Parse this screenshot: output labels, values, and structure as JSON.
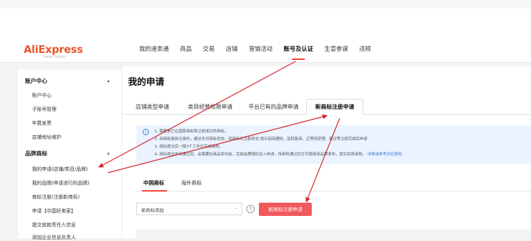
{
  "header": {
    "logo": "AliExpress",
    "logo_sub": "Seller Center",
    "nav": [
      "我的速卖通",
      "商品",
      "交易",
      "店铺",
      "营销活动",
      "账号及认证",
      "生意参谋",
      "违规"
    ],
    "active_nav": "账号及认证"
  },
  "sidebar": {
    "group1": {
      "label": "账户中心",
      "toggle": "▴",
      "items": [
        "账户中心",
        "子账号管理",
        "年费发票",
        "店铺地址维护"
      ]
    },
    "group2": {
      "label": "品牌商标",
      "toggle": "▴",
      "items": [
        "我的申请(店铺/类目/品牌)",
        "我的品牌(申请进行的品牌)",
        "商标注册(注册新商标)",
        "申请【中国好卖家】",
        "提交放款责任人信息",
        "添加企业信息负责人"
      ]
    }
  },
  "main": {
    "title": "我的申请",
    "tabs": [
      "店铺类型申请",
      "类目经营权限申请",
      "平台已有的品牌申请",
      "新商标注册申请"
    ],
    "active_tab": "新商标注册申请",
    "notice": {
      "icon": "info-icon",
      "lines": [
        "1. 需要是已在国家商标局注册成功的商标。",
        "2. 如商标是新注册的，建议先对商标状态，如商标对注册状态 提示驳回通知、驳回复审，正等待受理，建议等注册完成后申请",
        "3. 商标提交后一般3个工作日完成审核。",
        "4. 商标提交申请通过后，会需要在商品发布前，完成品牌授权及入申请，待审核通过后方可使用该品牌发布，提交后续审核。"
      ],
      "link": "详情请参考对应规则。"
    },
    "subtabs": [
      "中国商标",
      "海外商标"
    ],
    "active_subtab": "中国商标",
    "select": {
      "value": "新商标添加",
      "chevron": "⌄"
    },
    "help": "?",
    "button": "新商标注册申请"
  },
  "colors": {
    "brand": "#e8572a",
    "accent": "#e43",
    "button": "#f0585d",
    "annotation_arrow": "#d4242c",
    "notice_bg": "#eaf3ff"
  }
}
